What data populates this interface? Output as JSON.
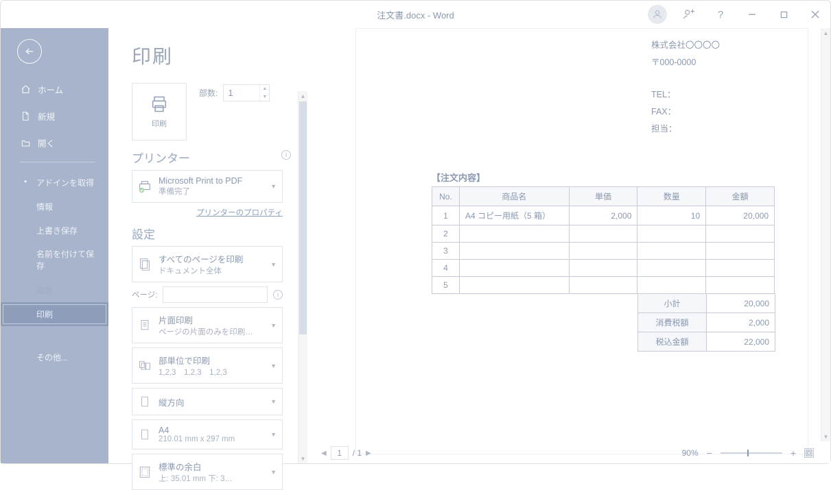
{
  "title": {
    "filename": "注文書.docx",
    "app": "Word"
  },
  "titlebar": {
    "help": "?"
  },
  "sidebar": {
    "home": "ホーム",
    "new": "新規",
    "open": "開く",
    "addins": "アドインを取得",
    "info": "情報",
    "save": "上書き保存",
    "saveas": "名前を付けて保存",
    "history": "履歴",
    "print": "印刷",
    "more": "その他..."
  },
  "panel": {
    "heading": "印刷",
    "print_label": "印刷",
    "copies_label": "部数:",
    "copies_value": "1",
    "printer_heading": "プリンター",
    "printer": {
      "name": "Microsoft Print to PDF",
      "status": "準備完了"
    },
    "printer_props": "プリンターのプロパティ",
    "settings_heading": "設定",
    "pages_label": "ページ:",
    "pages_value": "",
    "opt_allpages": {
      "l1": "すべてのページを印刷",
      "l2": "ドキュメント全体"
    },
    "opt_oneside": {
      "l1": "片面印刷",
      "l2": "ページの片面のみを印刷…"
    },
    "opt_collate": {
      "l1": "部単位で印刷",
      "l2": "1,2,3　1,2,3　1,2,3"
    },
    "opt_orient": {
      "l1": "縦方向"
    },
    "opt_paper": {
      "l1": "A4",
      "l2": "210.01 mm x 297 mm"
    },
    "opt_margin": {
      "l1": "標準の余白",
      "l2": "上: 35.01 mm 下: 3…"
    }
  },
  "doc": {
    "company": "株式会社〇〇〇〇",
    "postal": "〒000-0000",
    "tel": "TEL：",
    "fax": "FAX：",
    "contact": "担当：",
    "order_heading": "【注文内容】",
    "headers": {
      "no": "No.",
      "item": "商品名",
      "price": "単価",
      "qty": "数量",
      "amount": "金額"
    },
    "rows": [
      {
        "no": "1",
        "item": "A4 コピー用紙（5 箱）",
        "price": "2,000",
        "qty": "10",
        "amount": "20,000"
      },
      {
        "no": "2",
        "item": "",
        "price": "",
        "qty": "",
        "amount": ""
      },
      {
        "no": "3",
        "item": "",
        "price": "",
        "qty": "",
        "amount": ""
      },
      {
        "no": "4",
        "item": "",
        "price": "",
        "qty": "",
        "amount": ""
      },
      {
        "no": "5",
        "item": "",
        "price": "",
        "qty": "",
        "amount": ""
      }
    ],
    "summary": {
      "subtotal_l": "小計",
      "subtotal_v": "20,000",
      "tax_l": "消費税額",
      "tax_v": "2,000",
      "total_l": "税込金額",
      "total_v": "22,000"
    }
  },
  "status": {
    "page_current": "1",
    "page_sep": "/ 1",
    "zoom": "90%"
  }
}
